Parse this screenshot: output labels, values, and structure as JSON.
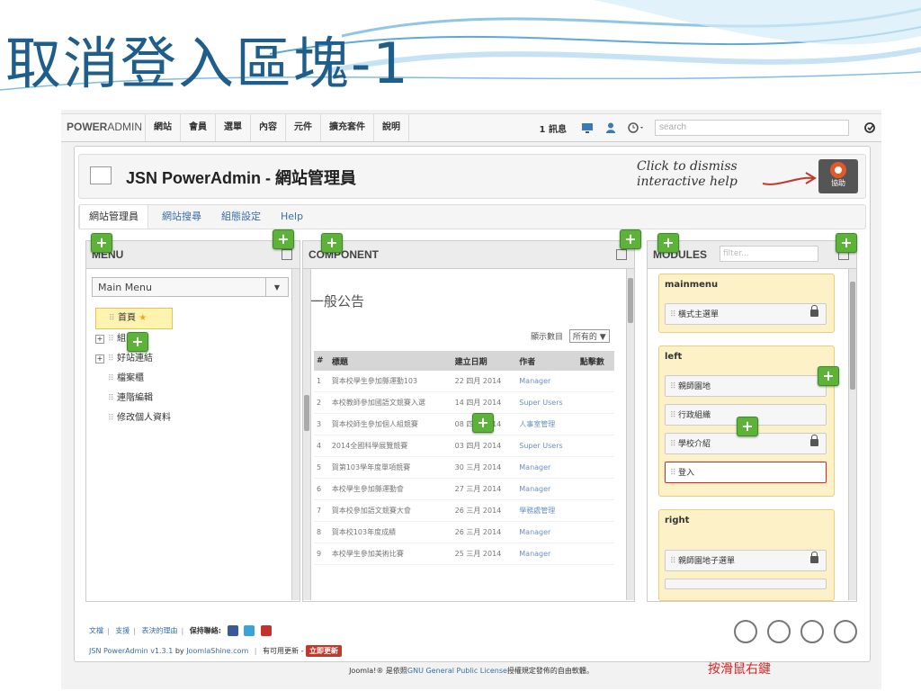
{
  "slide": {
    "title": "取消登入區塊-1"
  },
  "topbar": {
    "brand_bold": "POWER",
    "brand_thin": "ADMIN",
    "nav": [
      "網站",
      "會員",
      "選單",
      "內容",
      "元件",
      "擴充套件",
      "說明"
    ],
    "messages": "1 訊息",
    "search_placeholder": "search"
  },
  "header": {
    "title": "JSN PowerAdmin - 網站管理員",
    "hint_line1": "Click to dismiss",
    "hint_line2": "interactive help",
    "help_label": "協助"
  },
  "tabs": [
    "網站管理員",
    "網站搜尋",
    "組態設定",
    "Help"
  ],
  "menu_panel": {
    "title": "MENU",
    "dropdown": "Main Menu",
    "items": [
      "首頁",
      "組",
      "好站連結",
      "檔案櫃",
      "連階編輯",
      "修改個人資料"
    ]
  },
  "component_panel": {
    "title": "COMPONENT",
    "heading": "一般公告",
    "display_label": "顯示數目",
    "display_value": "所有的",
    "columns": [
      "#",
      "標題",
      "建立日期",
      "作者",
      "點擊數"
    ],
    "rows": [
      {
        "n": "1",
        "title": "賀本校學生參加縣運動103",
        "date": "22 四月 2014",
        "author": "Manager"
      },
      {
        "n": "2",
        "title": "本校教師參加國語文競賽入選",
        "date": "14 四月 2014",
        "author": "Super Users"
      },
      {
        "n": "3",
        "title": "賀本校師生參加個人組競賽",
        "date": "08 四月 2014",
        "author": "人事室管理"
      },
      {
        "n": "4",
        "title": "2014全國科學展覽競賽",
        "date": "03 四月 2014",
        "author": "Super Users"
      },
      {
        "n": "5",
        "title": "賀第103學年度單項競賽",
        "date": "30 三月 2014",
        "author": "Manager"
      },
      {
        "n": "6",
        "title": "本校學生參加縣運動會",
        "date": "27 三月 2014",
        "author": "Manager"
      },
      {
        "n": "7",
        "title": "賀本校參加語文競賽大會",
        "date": "26 三月 2014",
        "author": "學務處管理"
      },
      {
        "n": "8",
        "title": "賀本校103年度成績",
        "date": "26 三月 2014",
        "author": "Manager"
      },
      {
        "n": "9",
        "title": "本校學生參加美術比賽",
        "date": "25 三月 2014",
        "author": "Manager"
      }
    ]
  },
  "modules_panel": {
    "title": "MODULES",
    "filter_placeholder": "filter...",
    "positions": [
      {
        "name": "mainmenu",
        "items": [
          {
            "label": "橫式主選單",
            "locked": true
          }
        ]
      },
      {
        "name": "left",
        "items": [
          {
            "label": "親師園地",
            "locked": false
          },
          {
            "label": "行政組織",
            "locked": false
          },
          {
            "label": "學校介紹",
            "locked": true
          },
          {
            "label": "登入",
            "locked": false
          }
        ]
      },
      {
        "name": "right",
        "items": [
          {
            "label": "親師園地子選單",
            "locked": true
          }
        ]
      }
    ],
    "callout": "按滑鼠右鍵"
  },
  "footer": {
    "links": [
      "文檔",
      "支援",
      "表決的理由"
    ],
    "keep_contact": "保持聯絡:",
    "version_prefix": "JSN PowerAdmin v1.3.1",
    "by": "by",
    "company": "JoomlaShine.com",
    "update_text": "有可用更新 -",
    "update_button": "立即更新",
    "copyright_prefix": "Joomla!® 是依照",
    "copyright_link": "GNU General Public License",
    "copyright_suffix": "授權規定發佈的自由軟體。"
  },
  "colors": {
    "title": "#1f5d8a",
    "plus_green": "#5db33a",
    "callout_red": "#dd2222",
    "module_bg": "#fdf1c8"
  }
}
